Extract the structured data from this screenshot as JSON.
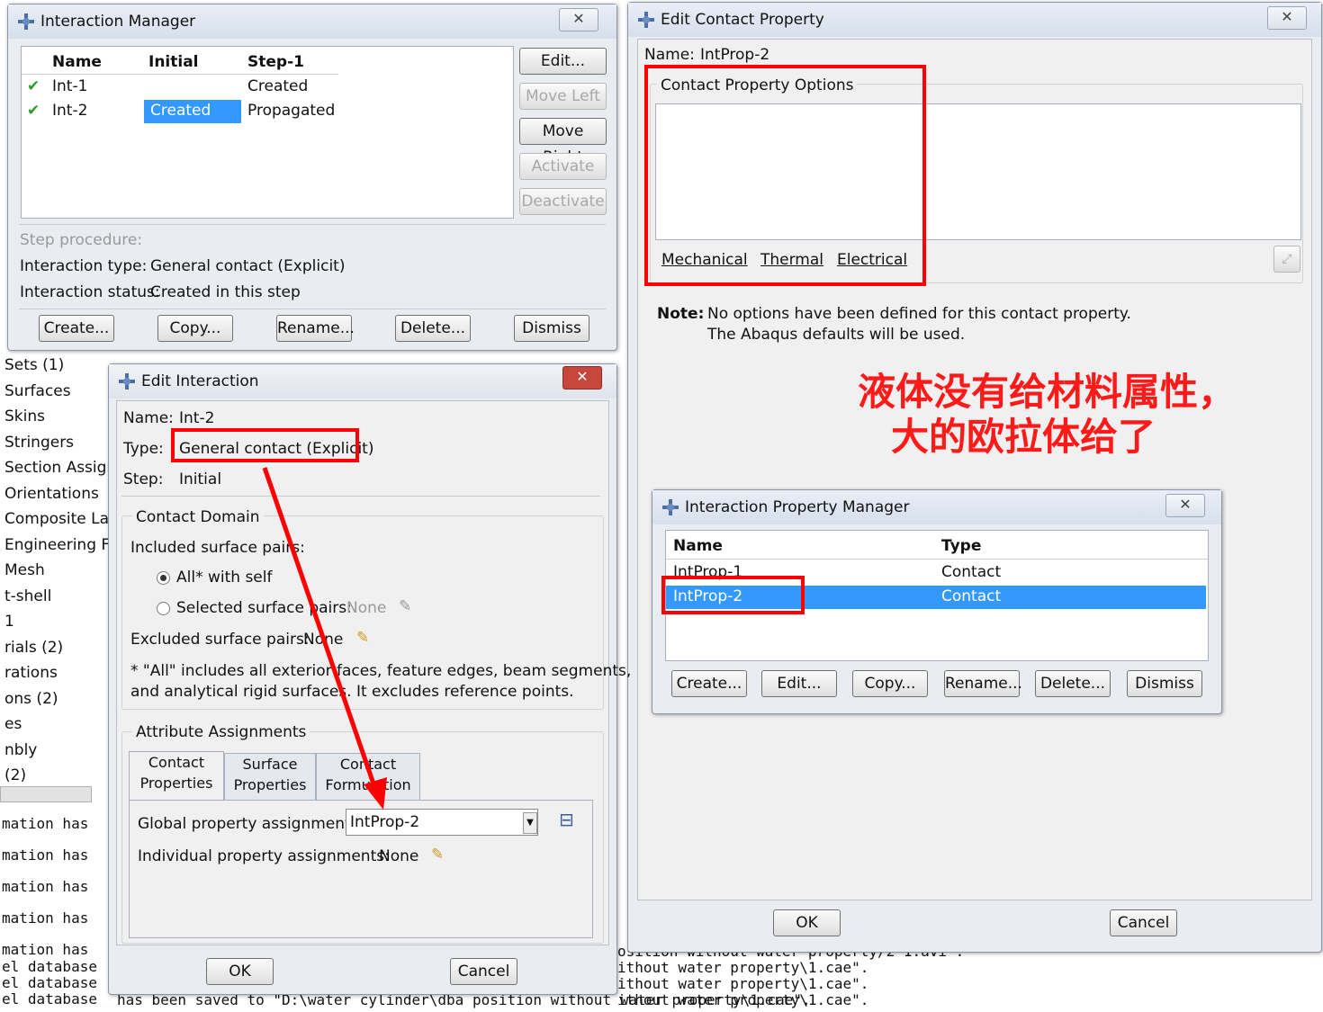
{
  "background": {
    "tree_items": [
      "Sets (1)",
      "Surfaces",
      "Skins",
      "Stringers",
      "Section Assign",
      "Orientations",
      "Composite Lay",
      "Engineering Fe",
      "Mesh",
      "t-shell",
      "1",
      "rials (2)",
      "rations",
      "ons (2)",
      "es",
      "nbly",
      "(2)"
    ],
    "console_left": [
      "mation has",
      "mation has",
      "mation has",
      "mation has",
      "mation has",
      "el database",
      "el database",
      "el database"
    ],
    "console_right": [
      "osition without water property/2-1.avi\".",
      "ithout water property\\1.cae\".",
      "ithout water property\\1.cae\".",
      "ithout water property\\1.cae\"."
    ],
    "console_last_mid": "has been saved to \"D:\\water cylinder\\dba position without water property\\1.cae\"."
  },
  "interaction_manager": {
    "title": "Interaction Manager",
    "columns": [
      "Name",
      "Initial",
      "Step-1"
    ],
    "rows": [
      {
        "name": "Int-1",
        "initial": "",
        "step1": "Created"
      },
      {
        "name": "Int-2",
        "initial": "Created",
        "step1": "Propagated"
      }
    ],
    "side_buttons": [
      "Edit...",
      "Move Left",
      "Move Right",
      "Activate",
      "Deactivate"
    ],
    "step_procedure_label": "Step procedure:",
    "interaction_type_label": "Interaction type:",
    "interaction_type_value": "General contact (Explicit)",
    "interaction_status_label": "Interaction status:",
    "interaction_status_value": "Created in this step",
    "bottom_buttons": [
      "Create...",
      "Copy...",
      "Rename...",
      "Delete...",
      "Dismiss"
    ]
  },
  "edit_interaction": {
    "title": "Edit Interaction",
    "name_label": "Name:",
    "name_value": "Int-2",
    "type_label": "Type:",
    "type_value": "General contact (Explicit)",
    "step_label": "Step:",
    "step_value": "Initial",
    "contact_domain_title": "Contact Domain",
    "included_label": "Included surface pairs:",
    "radio_all": "All* with self",
    "radio_selected": "Selected surface pairs:",
    "radio_selected_value": "None",
    "excluded_label": "Excluded surface pairs:",
    "excluded_value": "None",
    "note_line1": "* \"All\" includes all exterior faces, feature edges, beam segments,",
    "note_line2": "and analytical rigid surfaces. It excludes reference points.",
    "attribute_title": "Attribute Assignments",
    "tabs": [
      [
        "Contact",
        "Properties"
      ],
      [
        "Surface",
        "Properties"
      ],
      [
        "Contact",
        "Formulation"
      ]
    ],
    "global_label": "Global property assignment:",
    "global_value": "IntProp-2",
    "individual_label": "Individual property assignments:",
    "individual_value": "None",
    "ok": "OK",
    "cancel": "Cancel"
  },
  "edit_contact_property": {
    "title": "Edit Contact Property",
    "name_label": "Name:",
    "name_value": "IntProp-2",
    "options_title": "Contact Property Options",
    "menu": [
      "Mechanical",
      "Thermal",
      "Electrical"
    ],
    "note_label": "Note:",
    "note_line1": "No options have been defined for this contact property.",
    "note_line2": "The Abaqus defaults will be used.",
    "ok": "OK",
    "cancel": "Cancel"
  },
  "annotation": {
    "line1": "液体没有给材料属性，",
    "line2": "大的欧拉体给了",
    "color": "#ff1a1a"
  },
  "property_manager": {
    "title": "Interaction Property Manager",
    "columns": [
      "Name",
      "Type"
    ],
    "rows": [
      {
        "name": "IntProp-1",
        "type": "Contact"
      },
      {
        "name": "IntProp-2",
        "type": "Contact"
      }
    ],
    "buttons": [
      "Create...",
      "Edit...",
      "Copy...",
      "Rename...",
      "Delete...",
      "Dismiss"
    ]
  },
  "colors": {
    "selection": "#3399ff",
    "highlight_box": "#ff0000",
    "check": "#2a9d2a"
  }
}
